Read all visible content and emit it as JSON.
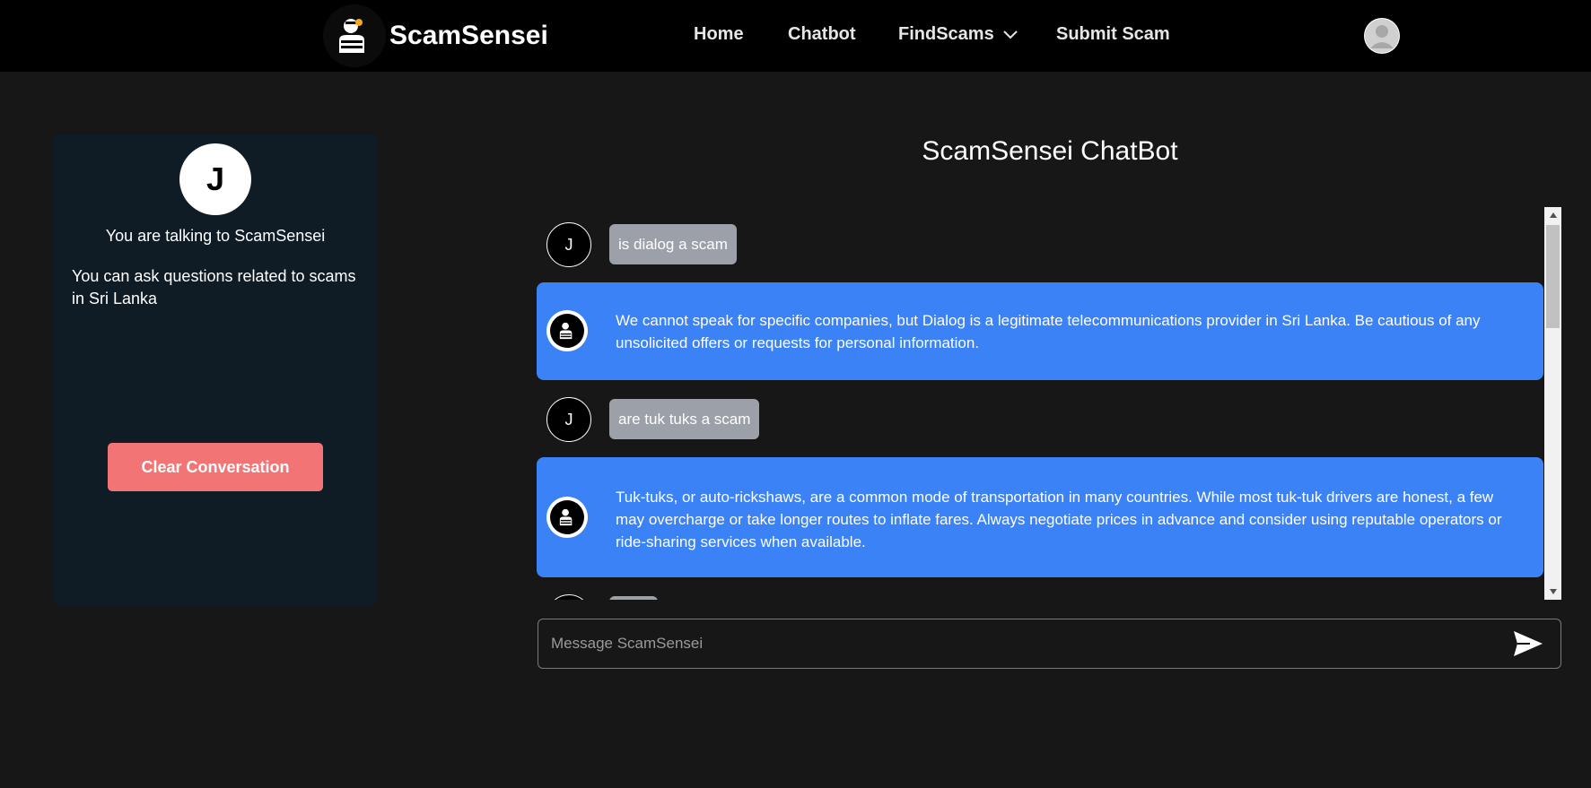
{
  "header": {
    "brand": "ScamSensei",
    "nav": {
      "home": "Home",
      "chatbot": "Chatbot",
      "findscams": "FindScams",
      "submit": "Submit Scam"
    }
  },
  "sidebar": {
    "avatar_letter": "J",
    "title": "You are talking to ScamSensei",
    "description": "You can ask questions related to scams in Sri Lanka",
    "clear_button": "Clear Conversation"
  },
  "chat": {
    "title": "ScamSensei ChatBot",
    "messages": [
      {
        "role": "user",
        "avatar": "J",
        "text": "is dialog a scam"
      },
      {
        "role": "bot",
        "text": "We cannot speak for specific companies, but Dialog is a legitimate telecommunications provider in Sri Lanka. Be cautious of any unsolicited offers or requests for personal information."
      },
      {
        "role": "user",
        "avatar": "J",
        "text": "are tuk tuks a scam"
      },
      {
        "role": "bot",
        "text": "Tuk-tuks, or auto-rickshaws, are a common mode of transportation in many countries. While most tuk-tuk drivers are honest, a few may overcharge or take longer routes to inflate fares. Always negotiate prices in advance and consider using reputable operators or ride-sharing services when available."
      }
    ],
    "input_placeholder": "Message ScamSensei"
  },
  "colors": {
    "bot_bubble": "#3b82f6",
    "user_bubble": "#9ca0a8",
    "clear_button": "#f27474",
    "sidebar_bg": "#0f1c26"
  }
}
